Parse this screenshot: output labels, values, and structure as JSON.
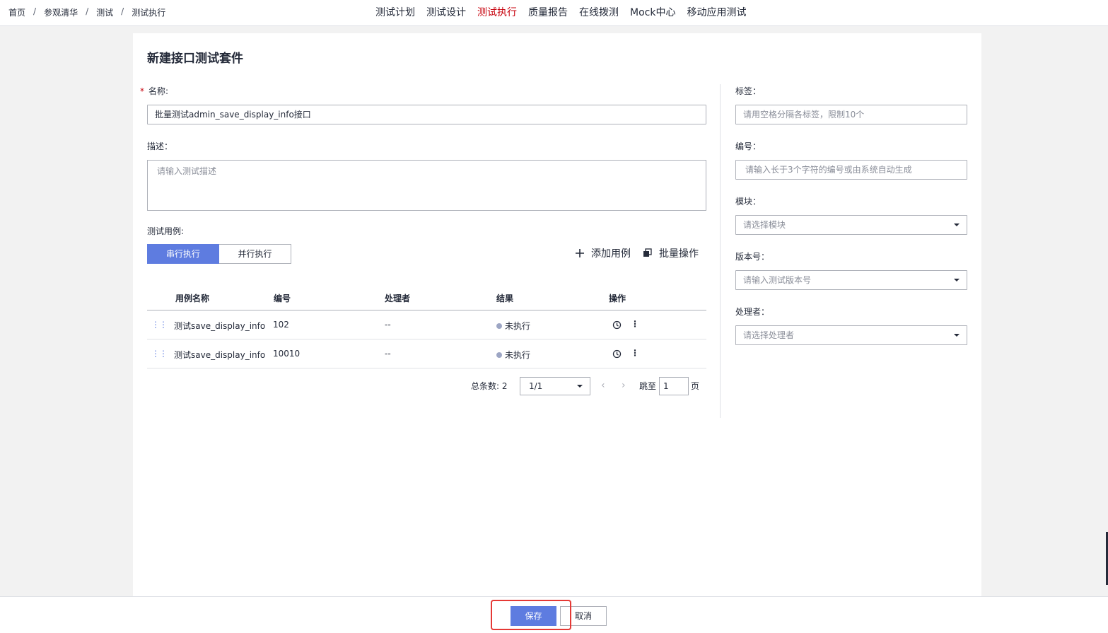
{
  "breadcrumb": [
    "首页",
    "参观清华",
    "测试",
    "测试执行"
  ],
  "breadcrumb_sep": "/",
  "nav": {
    "items": [
      "测试计划",
      "测试设计",
      "测试执行",
      "质量报告",
      "在线拨测",
      "Mock中心",
      "移动应用测试"
    ],
    "active": "测试执行"
  },
  "page_title": "新建接口测试套件",
  "form": {
    "name_required_mark": "*",
    "name_label": "名称:",
    "name_value": "批量测试admin_save_display_info接口",
    "desc_label": "描述：",
    "desc_placeholder": "请输入测试描述",
    "cases_label": "测试用例:"
  },
  "exec_mode": {
    "serial": "串行执行",
    "parallel": "并行执行",
    "selected": "串行执行"
  },
  "toolbar": {
    "add_case": "添加用例",
    "batch_ops": "批量操作"
  },
  "table": {
    "columns": [
      "用例名称",
      "编号",
      "处理者",
      "结果",
      "操作"
    ],
    "rows": [
      {
        "name": "测试save_display_info",
        "id": "102",
        "handler": "--",
        "result": "未执行"
      },
      {
        "name": "测试save_display_info",
        "id": "10010",
        "handler": "--",
        "result": "未执行"
      }
    ]
  },
  "pagination": {
    "total_label": "总条数: 2",
    "page_value": "1/1",
    "prev": "‹",
    "next": "›",
    "jump_label": "跳至",
    "jump_value": "1",
    "page_suffix": "页"
  },
  "right_panel": {
    "tags_label": "标签：",
    "tags_placeholder": "请用空格分隔各标签，限制10个",
    "number_label": "编号：",
    "number_placeholder": "请输入长于3个字符的编号或由系统自动生成",
    "module_label": "模块：",
    "module_placeholder": "请选择模块",
    "version_label": "版本号：",
    "version_placeholder": "请输入测试版本号",
    "handler_label": "处理者：",
    "handler_placeholder": "请选择处理者"
  },
  "footer": {
    "save": "保存",
    "cancel": "取消"
  },
  "colors": {
    "primary": "#5e7ce0",
    "active_nav": "#c7000b",
    "highlight": "#e53935"
  },
  "icons": {
    "add": "plus-icon",
    "batch": "batch-icon",
    "history": "history-icon",
    "more": "more-icon",
    "drag": "drag-handle-icon",
    "dropdown": "chevron-down-icon"
  }
}
